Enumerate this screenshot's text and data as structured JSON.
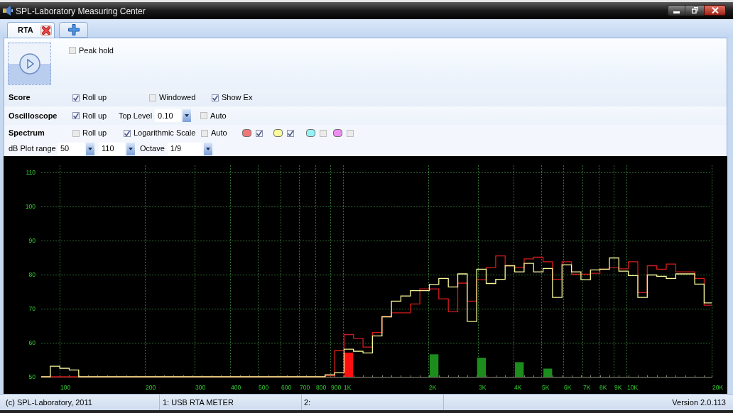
{
  "window": {
    "title": "SPL-Laboratory Measuring Center"
  },
  "tabs": [
    {
      "kind": "document",
      "label": "RTA",
      "selected": true
    },
    {
      "kind": "add",
      "selected": false
    }
  ],
  "peak_hold": {
    "label": "Peak hold",
    "checked": false
  },
  "settings": [
    {
      "kind": "group",
      "label": "Score",
      "controls": [
        {
          "kind": "checkbox",
          "label": "Roll up",
          "checked": true
        },
        {
          "kind": "checkbox",
          "label": "Windowed",
          "checked": false
        },
        {
          "kind": "checkbox",
          "label": "Show Ex",
          "checked": true
        }
      ]
    },
    {
      "kind": "group",
      "label": "Oscilloscope",
      "controls": [
        {
          "kind": "checkbox",
          "label": "Roll up",
          "checked": true
        },
        {
          "kind": "combo",
          "label": "Top Level",
          "value": "0.10"
        },
        {
          "kind": "checkbox",
          "label": "Auto",
          "checked": false
        }
      ]
    },
    {
      "kind": "group",
      "label": "Spectrum",
      "controls": [
        {
          "kind": "checkbox",
          "label": "Roll up",
          "checked": false
        },
        {
          "kind": "checkbox",
          "label": "Logarithmic Scale",
          "checked": true
        },
        {
          "kind": "checkbox",
          "label": "Auto",
          "checked": false
        },
        {
          "kind": "channel",
          "color": "#f07878",
          "checked": true
        },
        {
          "kind": "channel",
          "color": "#fcfb9a",
          "checked": true
        },
        {
          "kind": "channel",
          "color": "#93f3f5",
          "checked": false
        },
        {
          "kind": "channel",
          "color": "#ee8cf0",
          "checked": false
        }
      ]
    },
    {
      "kind": "field",
      "label": "dB Plot range",
      "controls": [
        {
          "kind": "combo",
          "value": "50"
        },
        {
          "kind": "combo",
          "value": "110"
        },
        {
          "kind": "combo",
          "label": "Octave",
          "value": "1/9"
        }
      ]
    }
  ],
  "spectrum": {
    "level_labels": [
      "110",
      "100",
      "90",
      "80",
      "70",
      "60",
      "50"
    ],
    "frequency_labels": [
      "100",
      "200",
      "300",
      "400",
      "500",
      "600",
      "700",
      "800",
      "900",
      "1K",
      "2K",
      "3K",
      "4K",
      "5K",
      "6K",
      "7K",
      "8K",
      "9K",
      "10K",
      "20K"
    ]
  },
  "status_bar": {
    "copyright": "(c) SPL-Laboratory, 2011",
    "device_1": "1: USB RTA METER",
    "device_2": "2:",
    "version": "Version 2.0.113"
  }
}
